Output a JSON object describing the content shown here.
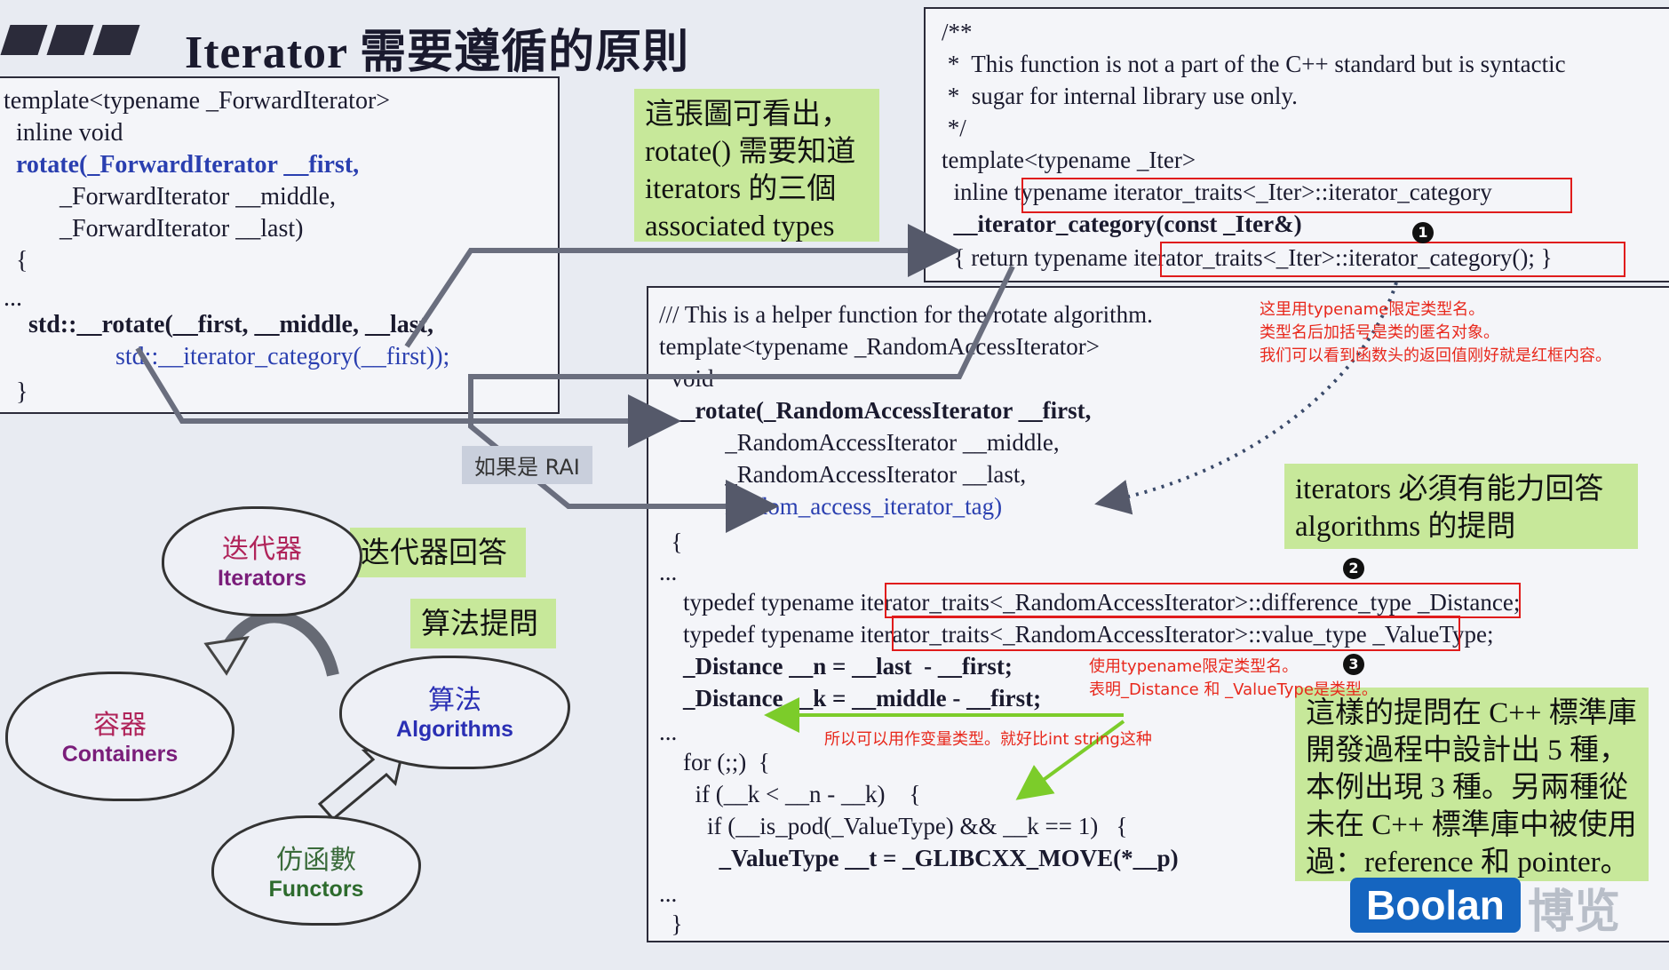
{
  "title": "Iterator 需要遵循的原則",
  "left_code": [
    "template<typename _ForwardIterator>",
    "  inline void",
    "  rotate(_ForwardIterator __first,",
    "         _ForwardIterator __middle,",
    "         _ForwardIterator __last)",
    "  {",
    "...",
    "    std::__rotate(__first, __middle, __last,",
    "                  std::__iterator_category(__first));",
    "  }"
  ],
  "top_right_code": [
    "/**",
    " *  This function is not a part of the C++ standard but is syntactic",
    " *  sugar for internal library use only.",
    " */",
    "template<typename _Iter>",
    "  inline typename iterator_traits<_Iter>::iterator_category",
    "  __iterator_category(const _Iter&)",
    "  { return typename iterator_traits<_Iter>::iterator_category(); }"
  ],
  "main_code": [
    "/// This is a helper function for the rotate algorithm.",
    "template<typename _RandomAccessIterator>",
    "  void",
    "  __rotate(_RandomAccessIterator __first,",
    "           _RandomAccessIterator __middle,",
    "           _RandomAccessIterator __last,",
    "           random_access_iterator_tag)",
    "  {",
    "...",
    "    typedef typename iterator_traits<_RandomAccessIterator>::difference_type _Distance;",
    "    typedef typename iterator_traits<_RandomAccessIterator>::value_type _ValueType;",
    "    _Distance __n = __last  - __first;",
    "    _Distance __k = __middle - __first;",
    "...",
    "    for (;;)  {",
    "      if (__k < __n - __k)    {",
    "        if (__is_pod(_ValueType) && __k == 1)   {",
    "          _ValueType __t = _GLIBCXX_MOVE(*__p)",
    "...",
    "  }"
  ],
  "green_top": "這張圖可看出，rotate() 需要知道 iterators 的三個 associated types",
  "green_right": "iterators 必須有能力回答 algorithms 的提問",
  "green_bottom": "這樣的提問在 C++ 標準庫開發過程中設計出 5 種，本例出現 3 種。另兩種從未在 C++ 標準庫中被使用過：reference 和 pointer。",
  "label_answer": "迭代器回答",
  "label_ask": "算法提問",
  "rai_label": "如果是 RAI",
  "note_1": "这里用typename限定类型名。\n类型名后加括号是类的匿名对象。\n我们可以看到函数头的返回值刚好就是红框内容。",
  "note_2": "使用typename限定类型名。\n表明_Distance 和 _ValueType是类型。",
  "note_3": "所以可以用作变量类型。就好比int string这种",
  "badges": [
    "1",
    "2",
    "3"
  ],
  "clouds": {
    "iterators": {
      "cn": "迭代器",
      "en": "Iterators"
    },
    "containers": {
      "cn": "容器",
      "en": "Containers"
    },
    "algorithms": {
      "cn": "算法",
      "en": "Algorithms"
    },
    "functors": {
      "cn": "仿函數",
      "en": "Functors"
    }
  },
  "logo": "Boolan",
  "logo_cn": "博览",
  "colors": {
    "background": "#e8ebf2",
    "green": "#c7e89a",
    "red": "#e01c1c",
    "keyword_blue": "#2a3fb0",
    "logo_blue": "#1565c0"
  }
}
